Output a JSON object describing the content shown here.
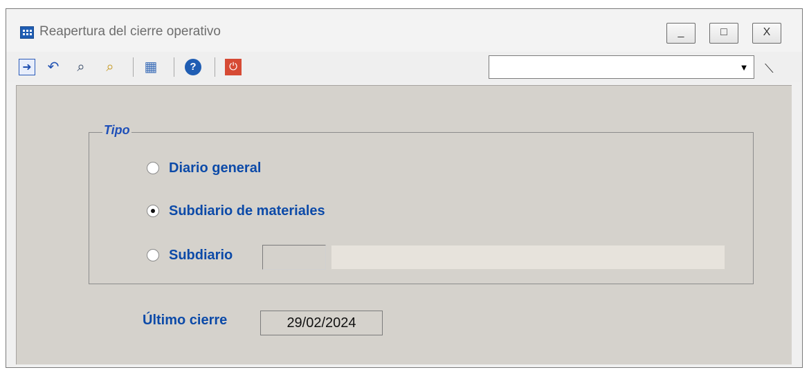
{
  "window": {
    "title": "Reapertura del cierre operativo",
    "controls": {
      "minimize": "_",
      "maximize": "□",
      "close": "X"
    }
  },
  "toolbar": {
    "buttons": [
      {
        "icon": "arrow-right-icon",
        "glyph": "➜"
      },
      {
        "icon": "undo-icon",
        "glyph": "↶"
      },
      {
        "icon": "binoculars-icon",
        "glyph": "⌕"
      },
      {
        "icon": "magnifier-icon",
        "glyph": "⌕"
      },
      {
        "icon": "new-record-icon",
        "glyph": "▦"
      },
      {
        "icon": "help-icon",
        "glyph": "?"
      },
      {
        "icon": "power-icon",
        "glyph": "⏻"
      }
    ],
    "combo_value": "",
    "combo_arrow": "▼",
    "wand_icon": "magic-wand-icon"
  },
  "form": {
    "group_label": "Tipo",
    "options": [
      {
        "label": "Diario general",
        "selected": false
      },
      {
        "label": "Subdiario de materiales",
        "selected": true
      },
      {
        "label": "Subdiario",
        "selected": false
      }
    ],
    "subdiario_code": "",
    "subdiario_name": "",
    "last_close_label": "Último cierre",
    "last_close_value": "29/02/2024"
  }
}
